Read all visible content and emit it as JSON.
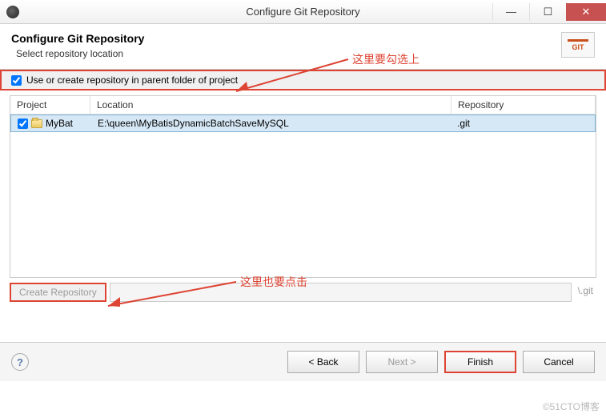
{
  "window": {
    "title": "Configure Git Repository"
  },
  "header": {
    "title": "Configure Git Repository",
    "subtitle": "Select repository location",
    "git_label": "GIT"
  },
  "checkbox": {
    "label": "Use or create repository in parent folder of project"
  },
  "table": {
    "headers": {
      "project": "Project",
      "location": "Location",
      "repository": "Repository"
    },
    "rows": [
      {
        "project": "MyBat",
        "location": "E:\\queen\\MyBatisDynamicBatchSaveMySQL",
        "repository": ".git"
      }
    ]
  },
  "create": {
    "button": "Create Repository",
    "suffix": "\\.git"
  },
  "footer": {
    "back": "< Back",
    "next": "Next >",
    "finish": "Finish",
    "cancel": "Cancel"
  },
  "annotations": {
    "top": "这里要勾选上",
    "bottom": "这里也要点击"
  },
  "watermark": "©51CTO博客"
}
